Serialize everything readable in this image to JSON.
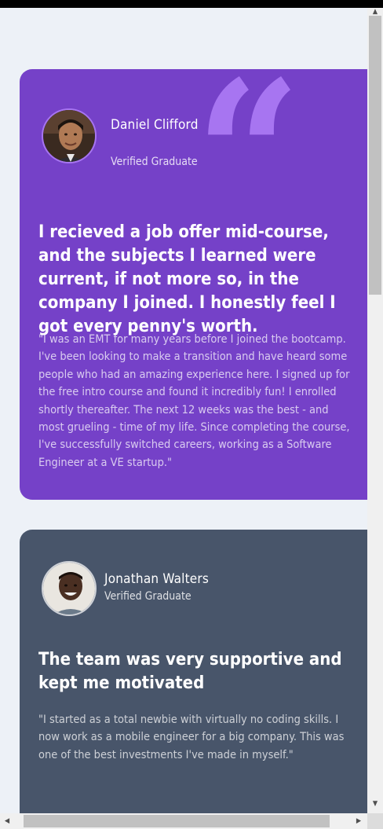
{
  "testimonials": [
    {
      "name": "Daniel Clifford",
      "role": "Verified Graduate",
      "headline": "I recieved a job offer mid-course, and the subjects I learned were current, if not more so, in the company I joined. I honestly feel I got every penny's worth.",
      "body": "\"I was an EMT for many years before I joined the bootcamp. I've been looking to make a transition and have heard some people who had an amazing experience here. I signed up for the free intro course and found it incredibly fun! I enrolled shortly thereafter. The next 12 weeks was the best - and most grueling - time of my life. Since completing the course, I've successfully switched careers, working as a Software Engineer at a VE startup.\"",
      "card_color": "#7541c8",
      "quote_color": "#a775f1"
    },
    {
      "name": "Jonathan Walters",
      "role": "Verified Graduate",
      "headline": "The team was very supportive and kept me motivated",
      "body": "\"I started as a total newbie with virtually no coding skills. I now work as a mobile engineer for a big company. This was one of the best investments I've made in myself.\"",
      "card_color": "#48556a"
    }
  ],
  "icons": {
    "quote": "quotation-mark-icon",
    "scroll_up": "triangle-up-icon",
    "scroll_down": "triangle-down-icon",
    "scroll_left": "triangle-left-icon",
    "scroll_right": "triangle-right-icon"
  },
  "page_background": "#edf1f7"
}
